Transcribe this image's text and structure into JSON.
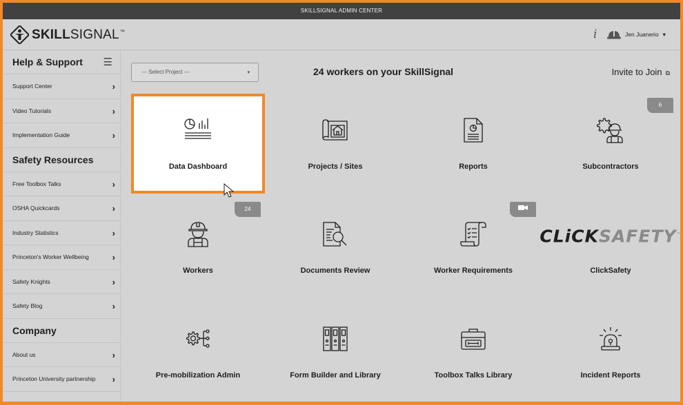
{
  "window": {
    "title": "SKILLSIGNAL ADMIN CENTER"
  },
  "header": {
    "logo_bold": "SKILL",
    "logo_light": "SIGNAL",
    "logo_tm": "™",
    "info_glyph": "i",
    "user_name": "Jen Juanerio",
    "user_caret": "▾"
  },
  "sidebar": {
    "sections": [
      {
        "title": "Help & Support",
        "items": [
          "Support Center",
          "Video Tutorials",
          "Implementation Guide"
        ]
      },
      {
        "title": "Safety Resources",
        "items": [
          "Free Toolbox Talks",
          "OSHA Quickcards",
          "Industry Statistics",
          "Princeton's Worker Wellbeing",
          "Safety Knights",
          "Safety Blog"
        ]
      },
      {
        "title": "Company",
        "items": [
          "About us",
          "Princeton University partnership"
        ]
      }
    ],
    "chevron": "›"
  },
  "toolbar": {
    "select_placeholder": "--- Select Project ---",
    "select_caret": "▾",
    "worker_count_text": "24 workers on your SkillSignal",
    "invite_label": "Invite to Join"
  },
  "tiles": [
    {
      "label": "Data Dashboard",
      "icon": "dashboard-icon",
      "active": true
    },
    {
      "label": "Projects / Sites",
      "icon": "blueprint-house-icon"
    },
    {
      "label": "Reports",
      "icon": "report-chart-icon"
    },
    {
      "label": "Subcontractors",
      "icon": "subcontractor-gear-icon",
      "badge": "6"
    },
    {
      "label": "Workers",
      "icon": "worker-hardhat-icon",
      "badge": "24"
    },
    {
      "label": "Documents Review",
      "icon": "document-search-icon"
    },
    {
      "label": "Worker Requirements",
      "icon": "checklist-scroll-icon",
      "badge_icon": "video-camera-icon"
    },
    {
      "label": "ClickSafety",
      "logo_text_a": "CLiCK",
      "logo_text_b": "SAFETY",
      "logo_tm": "™"
    },
    {
      "label": "Pre-mobilization Admin",
      "icon": "gear-network-icon"
    },
    {
      "label": "Form Builder and Library",
      "icon": "binders-icon"
    },
    {
      "label": "Toolbox Talks Library",
      "icon": "toolbox-icon"
    },
    {
      "label": "Incident Reports",
      "icon": "siren-icon"
    }
  ],
  "colors": {
    "accent": "#f08a28",
    "titlebar": "#414141",
    "background": "#d4d4d4",
    "badge": "#8a8a8a"
  }
}
